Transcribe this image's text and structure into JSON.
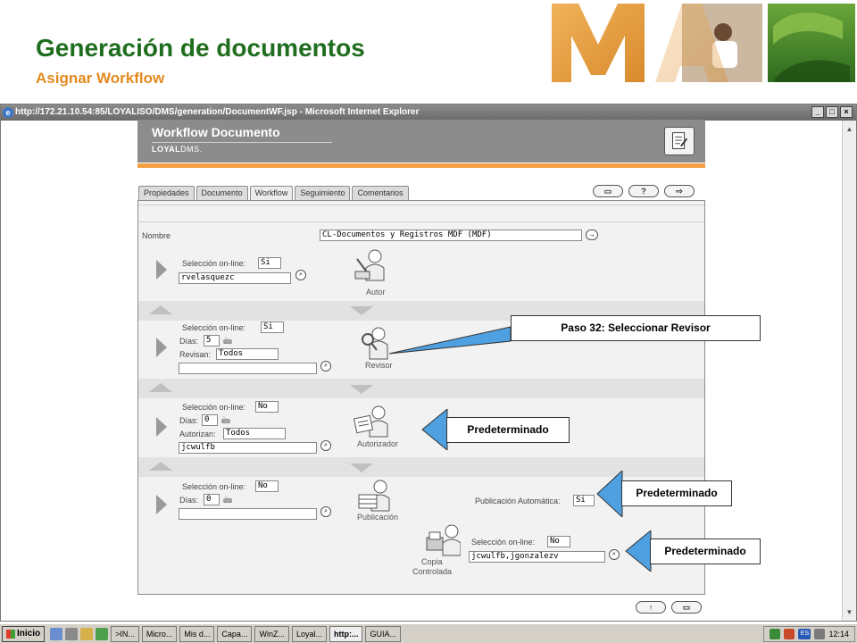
{
  "slide": {
    "title": "Generación de documentos",
    "subtitle": "Asignar Workflow"
  },
  "browser": {
    "title": "http://172.21.10.54:85/LOYALISO/DMS/generation/DocumentWF.jsp - Microsoft Internet Explorer"
  },
  "app": {
    "title": "Workflow Documento",
    "brand_bold": "LOYAL",
    "brand_rest": "DMS."
  },
  "tabs": [
    "Propiedades",
    "Documento",
    "Workflow",
    "Seguimiento",
    "Comentarios"
  ],
  "tool_buttons": [
    "▭",
    "?",
    "⇨"
  ],
  "form": {
    "nombre_label": "Nombre",
    "nombre_value": "CL-Documentos y Registros MDF (MDF)",
    "autor": {
      "sel_label": "Selección on-line:",
      "sel_value": "Si",
      "user_value": "rvelasquezc",
      "role_label": "Autor"
    },
    "revisor": {
      "sel_label": "Selección on-line:",
      "sel_value": "Si",
      "dias_label": "Días:",
      "dias_value": "5",
      "revisan_label": "Revisan:",
      "revisan_value": "Todos",
      "user_value": "",
      "role_label": "Revisor"
    },
    "autorizador": {
      "sel_label": "Selección on-line:",
      "sel_value": "No",
      "dias_label": "Días:",
      "dias_value": "0",
      "autorizan_label": "Autorizan:",
      "autorizan_value": "Todos",
      "user_value": "jcwulfb",
      "role_label": "Autorizador"
    },
    "publicacion": {
      "sel_label": "Selección on-line:",
      "sel_value": "No",
      "dias_label": "Días:",
      "dias_value": "0",
      "user_value": "",
      "pub_auto_label": "Publicación Automática:",
      "pub_auto_value": "Si",
      "role_label": "Publicación"
    },
    "copia": {
      "sel_label": "Selección on-line:",
      "sel_value": "No",
      "user_value": "jcwulfb,jgonzalezv",
      "role_label_1": "Copia",
      "role_label_2": "Controlada"
    }
  },
  "callouts": {
    "revisor": "Paso 32: Seleccionar Revisor",
    "autorizador": "Predeterminado",
    "publicacion": "Predeterminado",
    "copia": "Predeterminado"
  },
  "taskbar": {
    "start": "Inicio",
    "tasks": [
      ">IN...",
      "Micro...",
      "Mis d...",
      "Capa...",
      "WinZ...",
      "Loyal...",
      "http:...",
      "GUIA..."
    ],
    "active_index": 6,
    "lang": "ES",
    "clock": "12:14"
  },
  "colors": {
    "title_green": "#1f6e1f",
    "subtitle_orange": "#e58a1f",
    "callout_blue": "#4fa0e0"
  }
}
